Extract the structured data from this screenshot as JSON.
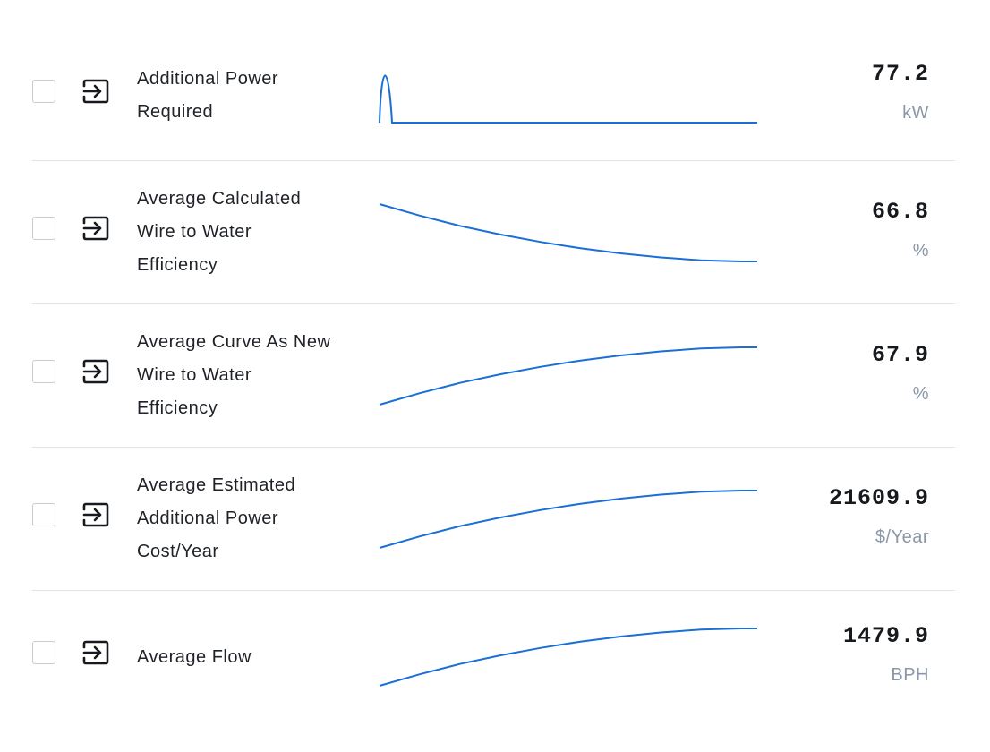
{
  "accent": "#1a6fd6",
  "metrics": [
    {
      "label_lines": [
        "Additional Power",
        "Required"
      ],
      "value": "77.2",
      "unit": "kW",
      "trend": [
        0.25,
        0.0,
        0.25,
        1.0,
        1.0,
        1.0,
        1.0,
        1.0,
        1.0,
        1.0
      ]
    },
    {
      "label_lines": [
        "Average Calculated",
        "Wire to Water",
        "Efficiency"
      ],
      "value": "66.8",
      "unit": "%",
      "trend": [
        0.0,
        0.2,
        0.38,
        0.53,
        0.66,
        0.77,
        0.86,
        0.93,
        0.98,
        1.0
      ]
    },
    {
      "label_lines": [
        "Average Curve As New",
        "Wire to Water",
        "Efficiency"
      ],
      "value": "67.9",
      "unit": "%",
      "trend": [
        1.0,
        0.8,
        0.62,
        0.47,
        0.34,
        0.23,
        0.14,
        0.07,
        0.02,
        0.0
      ]
    },
    {
      "label_lines": [
        "Average Estimated",
        "Additional Power",
        "Cost/Year"
      ],
      "value": "21609.9",
      "unit": "$/Year",
      "trend": [
        1.0,
        0.8,
        0.62,
        0.47,
        0.34,
        0.23,
        0.14,
        0.07,
        0.02,
        0.0
      ]
    },
    {
      "label_lines": [
        "Average Flow"
      ],
      "value": "1479.9",
      "unit": "BPH",
      "trend": [
        1.0,
        0.8,
        0.62,
        0.47,
        0.34,
        0.23,
        0.14,
        0.07,
        0.02,
        0.0
      ]
    }
  ]
}
